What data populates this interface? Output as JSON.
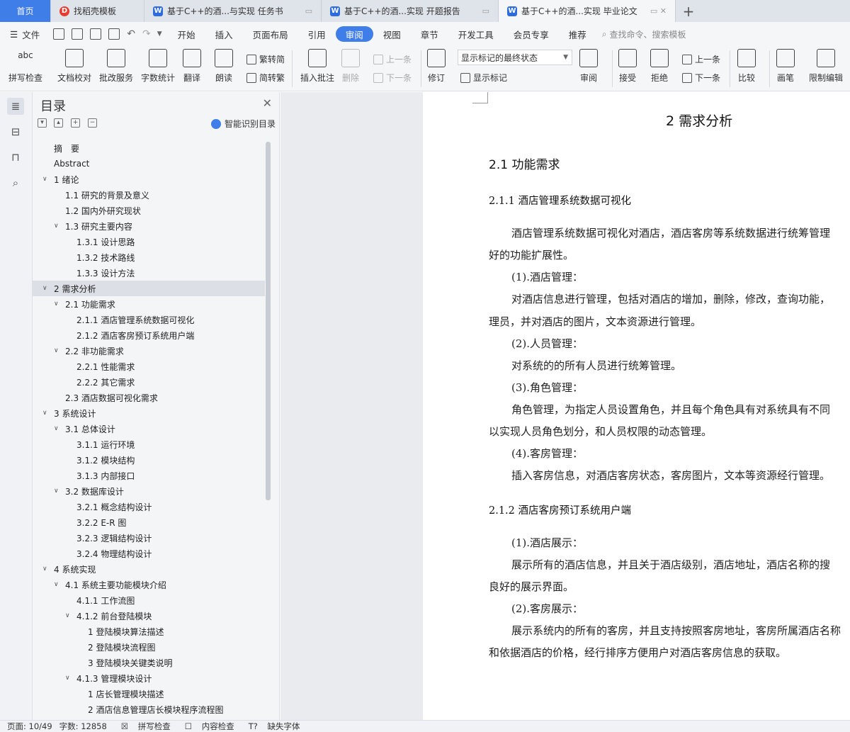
{
  "tabs": [
    {
      "label": "首页",
      "icon": "home"
    },
    {
      "label": "找稻壳模板",
      "icon": "docer-icon"
    },
    {
      "label": "基于C++的酒...与实现 任务书",
      "icon": "wps-writer-icon"
    },
    {
      "label": "基于C++的酒...实现 开题报告",
      "icon": "wps-writer-icon"
    },
    {
      "label": "基于C++的酒...实现 毕业论文",
      "icon": "wps-writer-icon",
      "active": true
    }
  ],
  "menu": {
    "file_label": "文件",
    "items": [
      "开始",
      "插入",
      "页面布局",
      "引用",
      "审阅",
      "视图",
      "章节",
      "开发工具",
      "会员专享",
      "推荐"
    ],
    "active": "审阅",
    "search_placeholder": "查找命令、搜索模板"
  },
  "ribbon": {
    "spellcheck": "拼写检查",
    "doc_proof": "文档校对",
    "batch_service": "批改服务",
    "word_count": "字数统计",
    "translate": "翻译",
    "read_aloud": "朗读",
    "to_traditional": "繁转简",
    "to_simplified": "简转繁",
    "insert_comment": "插入批注",
    "delete": "删除",
    "prev": "上一条",
    "next": "下一条",
    "revise": "修订",
    "mark_state": "显示标记的最终状态",
    "show_marks": "显示标记",
    "review": "审阅",
    "accept": "接受",
    "reject": "拒绝",
    "prev2": "上一条",
    "next2": "下一条",
    "compare": "比较",
    "pen": "画笔",
    "restrict": "限制编辑"
  },
  "toc": {
    "title": "目录",
    "smart_label": "智能识别目录",
    "entries": [
      {
        "text": "摘　要",
        "level": 0,
        "arrow": ""
      },
      {
        "text": "Abstract",
        "level": 0,
        "arrow": ""
      },
      {
        "text": "1  绪论",
        "level": 0,
        "arrow": "v"
      },
      {
        "text": "1.1  研究的背景及意义",
        "level": 1,
        "arrow": ""
      },
      {
        "text": "1.2  国内外研究现状",
        "level": 1,
        "arrow": ""
      },
      {
        "text": "1.3  研究主要内容",
        "level": 1,
        "arrow": "v"
      },
      {
        "text": "1.3.1  设计思路",
        "level": 2,
        "arrow": ""
      },
      {
        "text": "1.3.2  技术路线",
        "level": 2,
        "arrow": ""
      },
      {
        "text": "1.3.3  设计方法",
        "level": 2,
        "arrow": ""
      },
      {
        "text": "2  需求分析",
        "level": 0,
        "arrow": "v",
        "selected": true
      },
      {
        "text": "2.1  功能需求",
        "level": 1,
        "arrow": "v"
      },
      {
        "text": "2.1.1  酒店管理系统数据可视化",
        "level": 2,
        "arrow": ""
      },
      {
        "text": "2.1.2  酒店客房预订系统用户端",
        "level": 2,
        "arrow": ""
      },
      {
        "text": "2.2  非功能需求",
        "level": 1,
        "arrow": "v"
      },
      {
        "text": "2.2.1  性能需求",
        "level": 2,
        "arrow": ""
      },
      {
        "text": "2.2.2  其它需求",
        "level": 2,
        "arrow": ""
      },
      {
        "text": "2.3  酒店数据可视化需求",
        "level": 1,
        "arrow": ""
      },
      {
        "text": "3  系统设计",
        "level": 0,
        "arrow": "v"
      },
      {
        "text": "3.1  总体设计",
        "level": 1,
        "arrow": "v"
      },
      {
        "text": "3.1.1 运行环境",
        "level": 2,
        "arrow": ""
      },
      {
        "text": "3.1.2 模块结构",
        "level": 2,
        "arrow": ""
      },
      {
        "text": "3.1.3 内部接口",
        "level": 2,
        "arrow": ""
      },
      {
        "text": "3.2  数据库设计",
        "level": 1,
        "arrow": "v"
      },
      {
        "text": "3.2.1  概念结构设计",
        "level": 2,
        "arrow": ""
      },
      {
        "text": "3.2.2 E-R 图",
        "level": 2,
        "arrow": ""
      },
      {
        "text": "3.2.3  逻辑结构设计",
        "level": 2,
        "arrow": ""
      },
      {
        "text": "3.2.4  物理结构设计",
        "level": 2,
        "arrow": ""
      },
      {
        "text": "4  系统实现",
        "level": 0,
        "arrow": "v"
      },
      {
        "text": "4.1  系统主要功能模块介绍",
        "level": 1,
        "arrow": "v"
      },
      {
        "text": "4.1.1  工作流图",
        "level": 2,
        "arrow": ""
      },
      {
        "text": "4.1.2  前台登陆模块",
        "level": 2,
        "arrow": "v"
      },
      {
        "text": "1 登陆模块算法描述",
        "level": 3,
        "arrow": ""
      },
      {
        "text": "2  登陆模块流程图",
        "level": 3,
        "arrow": ""
      },
      {
        "text": "3 登陆模块关键类说明",
        "level": 3,
        "arrow": ""
      },
      {
        "text": "4.1.3 管理模块设计",
        "level": 2,
        "arrow": "v"
      },
      {
        "text": "1 店长管理模块描述",
        "level": 3,
        "arrow": ""
      },
      {
        "text": "2 酒店信息管理店长模块程序流程图",
        "level": 3,
        "arrow": ""
      }
    ]
  },
  "document": {
    "h1": "2  需求分析",
    "h2": "2.1  功能需求",
    "h3a": "2.1.1  酒店管理系统数据可视化",
    "p1a": "酒店管理系统数据可视化对酒店，酒店客房等系统数据进行统筹管理",
    "p1b": "好的功能扩展性。",
    "i1": "(1).酒店管理：",
    "p2a": "对酒店信息进行管理，包括对酒店的增加，删除，修改，查询功能，",
    "p2b": "理员，并对酒店的图片，文本资源进行管理。",
    "i2": "(2).人员管理：",
    "p3": "对系统的的所有人员进行统筹管理。",
    "i3": "(3).角色管理：",
    "p4a": "角色管理，为指定人员设置角色，并且每个角色具有对系统具有不同",
    "p4b": "以实现人员角色划分，和人员权限的动态管理。",
    "i4": "(4).客房管理：",
    "p5": "插入客房信息，对酒店客房状态，客房图片，文本等资源经行管理。",
    "h3b": "2.1.2  酒店客房预订系统用户端",
    "i5": "(1).酒店展示：",
    "p6a": "展示所有的酒店信息，并且关于酒店级别，酒店地址，酒店名称的搜",
    "p6b": "良好的展示界面。",
    "i6": "(2).客房展示：",
    "p7a": "展示系统内的所有的客房，并且支持按照客房地址，客房所属酒店名称",
    "p7b": "和依据酒店的价格，经行排序方便用户对酒店客房信息的获取。"
  },
  "status": {
    "page": "页面: 10/49",
    "words": "字数: 12858",
    "spell": "拼写检查",
    "content_check": "内容检查",
    "missing_font": "缺失字体"
  }
}
